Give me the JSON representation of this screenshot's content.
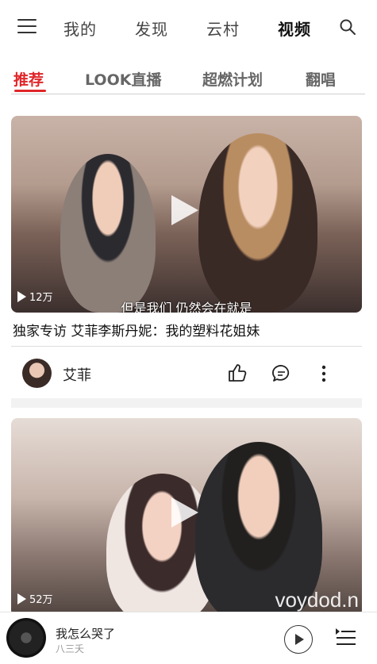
{
  "nav": {
    "menu_icon": "hamburger-icon",
    "tabs": [
      "我的",
      "发现",
      "云村",
      "视频"
    ],
    "active_tab": "视频",
    "search_icon": "search-icon"
  },
  "subtabs": {
    "items": [
      "推荐",
      "LOOK直播",
      "超燃计划",
      "翻唱"
    ],
    "active": "推荐",
    "accent": "#e0262a"
  },
  "videos": [
    {
      "views": "12万",
      "subtitle": "但是我们  仍然会在就是",
      "title": "独家专访 艾菲李斯丹妮：我的塑料花姐妹",
      "author": "艾菲"
    },
    {
      "views": "52万",
      "watermark": "voydod.n"
    }
  ],
  "player": {
    "song": "我怎么哭了",
    "artist": "八三夭"
  }
}
